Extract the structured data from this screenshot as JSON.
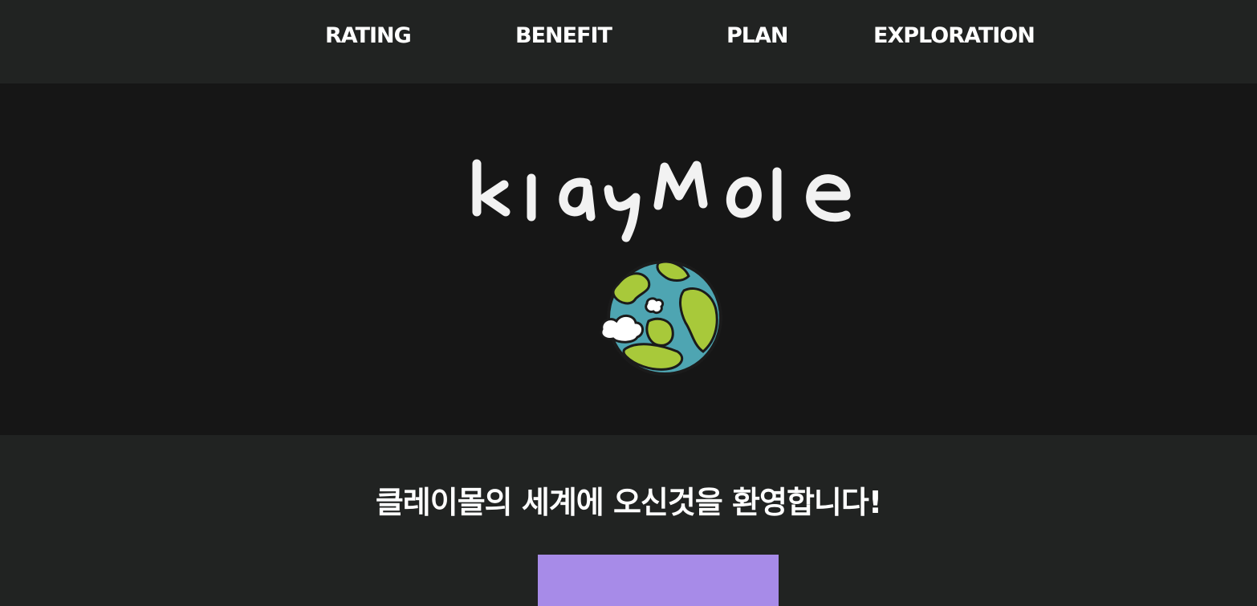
{
  "nav": {
    "items": [
      {
        "label": "RATING"
      },
      {
        "label": "BENEFIT"
      },
      {
        "label": "PLAN"
      },
      {
        "label": "EXPLORATION"
      }
    ]
  },
  "hero": {
    "logo_text": "klayMole",
    "globe_icon": "earth-globe-icon"
  },
  "welcome": {
    "text": "클레이몰의 세계에 오신것을 환영합니다!"
  },
  "cta": {
    "label": ""
  },
  "colors": {
    "background": "#212322",
    "hero_background": "#161616",
    "text": "#ffffff",
    "cta": "#a78be8",
    "globe_ocean": "#4ea5b2",
    "globe_land": "#a8c93a",
    "cloud": "#ffffff"
  }
}
